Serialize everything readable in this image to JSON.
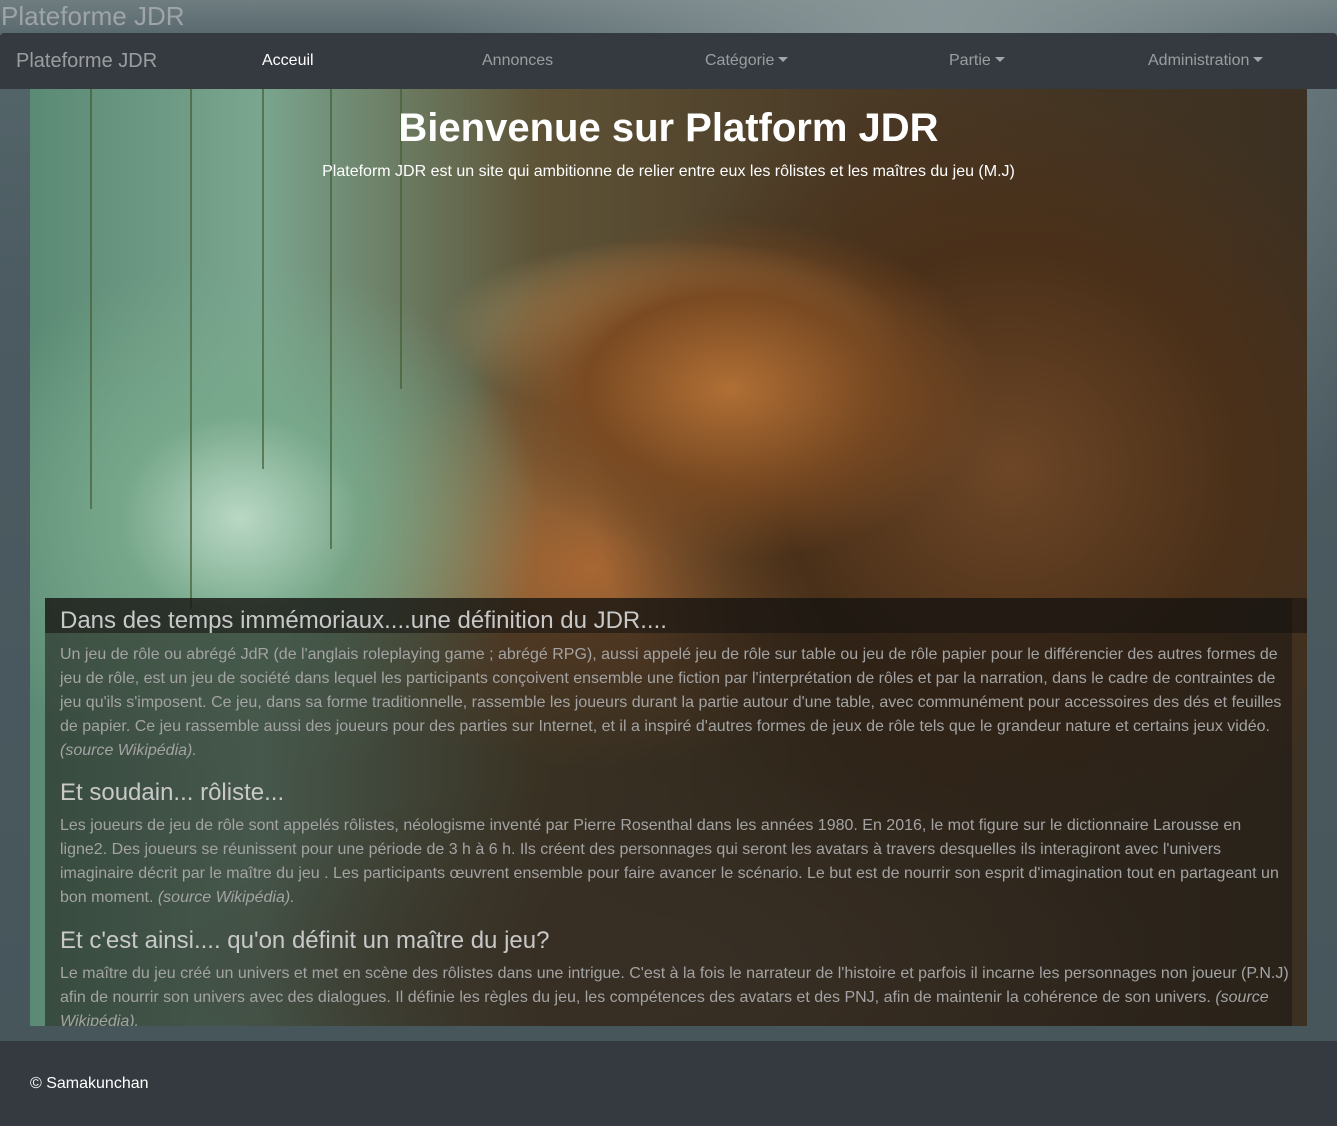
{
  "site": {
    "title": "Plateforme JDR"
  },
  "navbar": {
    "brand": "Plateforme JDR",
    "items": [
      {
        "label": "Acceuil",
        "active": true,
        "dropdown": false
      },
      {
        "label": "Annonces",
        "active": false,
        "dropdown": false
      },
      {
        "label": "Catégorie",
        "active": false,
        "dropdown": true
      },
      {
        "label": "Partie",
        "active": false,
        "dropdown": true
      },
      {
        "label": "Administration",
        "active": false,
        "dropdown": true
      }
    ]
  },
  "hero": {
    "title": "Bienvenue sur Platform JDR",
    "subtitle": "Plateform JDR est un site qui ambitionne de relier entre eux les rôlistes et les maîtres du jeu (M.J)"
  },
  "sections": [
    {
      "heading": "Dans des temps immémoriaux....une définition du JDR....",
      "text": "Un jeu de rôle ou abrégé JdR (de l'anglais roleplaying game ; abrégé RPG), aussi appelé jeu de rôle sur table ou jeu de rôle papier pour le différencier des autres formes de jeu de rôle, est un jeu de société dans lequel les participants conçoivent ensemble une fiction par l'interprétation de rôles et par la narration, dans le cadre de contraintes de jeu qu'ils s'imposent. Ce jeu, dans sa forme traditionnelle, rassemble les joueurs durant la partie autour d'une table, avec communément pour accessoires des dés et feuilles de papier. Ce jeu rassemble aussi des joueurs pour des parties sur Internet, et il a inspiré d'autres formes de jeux de rôle tels que le grandeur nature et certains jeux vidéo.",
      "source": "(source Wikipédia)."
    },
    {
      "heading": "Et soudain... rôliste...",
      "text": "Les joueurs de jeu de rôle sont appelés rôlistes, néologisme inventé par Pierre Rosenthal dans les années 1980. En 2016, le mot figure sur le dictionnaire Larousse en ligne2. Des joueurs se réunissent pour une période de 3 h à 6 h. Ils créent des personnages qui seront les avatars à travers desquelles ils interagiront avec l'univers imaginaire décrit par le maître du jeu . Les participants œuvrent ensemble pour faire avancer le scénario. Le but est de nourrir son esprit d'imagination tout en partageant un bon moment.",
      "source": "(source Wikipédia)."
    },
    {
      "heading": "Et c'est ainsi.... qu'on définit un maître du jeu?",
      "text": "Le maître du jeu créé un univers et met en scène des rôlistes dans une intrigue. C'est à la fois le narrateur de l'histoire et parfois il incarne les personnages non joueur (P.N.J) afin de nourrir son univers avec des dialogues. Il définie les règles du jeu, les compétences des avatars et des PNJ, afin de maintenir la cohérence de son univers.",
      "source": "(source Wikipédia)."
    }
  ],
  "footer": {
    "copyright": "© Samakunchan"
  }
}
